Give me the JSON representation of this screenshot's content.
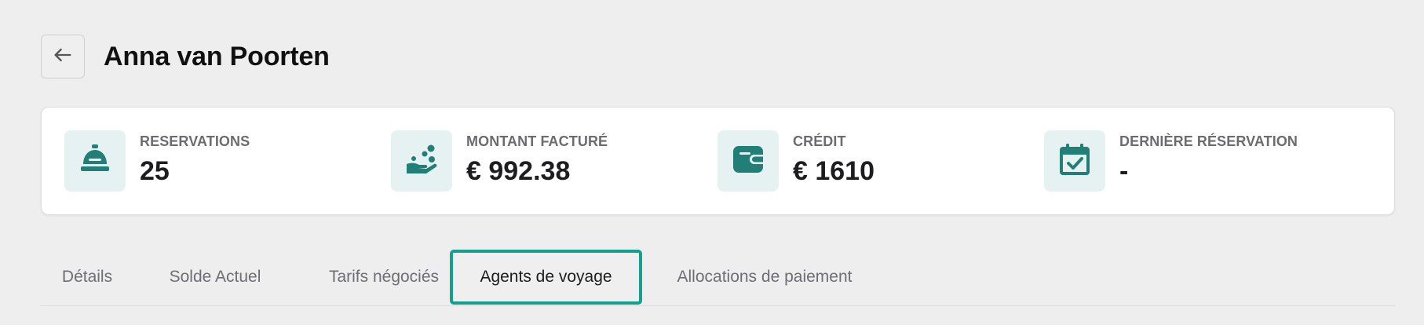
{
  "header": {
    "back_icon": "arrow-left-icon",
    "title": "Anna van Poorten"
  },
  "stats": [
    {
      "icon": "service-bell-icon",
      "label": "RESERVATIONS",
      "value": "25"
    },
    {
      "icon": "hand-coins-icon",
      "label": "MONTANT FACTURÉ",
      "value": "€ 992.38"
    },
    {
      "icon": "wallet-icon",
      "label": "CRÉDIT",
      "value": "€ 1610"
    },
    {
      "icon": "calendar-check-icon",
      "label": "DERNIÈRE RÉSERVATION",
      "value": "-"
    }
  ],
  "tabs": [
    {
      "label": "Détails",
      "active": false
    },
    {
      "label": "Solde Actuel",
      "active": false
    },
    {
      "label": "Tarifs négociés",
      "active": false
    },
    {
      "label": "Agents de voyage",
      "active": true
    },
    {
      "label": "Allocations de paiement",
      "active": false
    }
  ],
  "colors": {
    "accent": "#14a08e",
    "icon_teal": "#227f78",
    "icon_bg": "#e6f2f1",
    "page_bg": "#eeeeee"
  }
}
